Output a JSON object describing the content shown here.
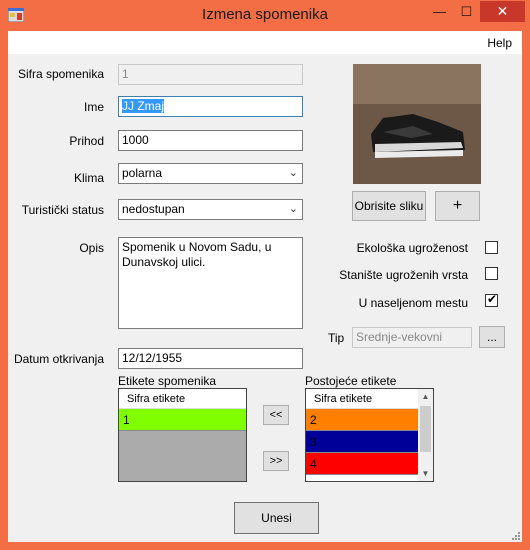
{
  "window": {
    "title": "Izmena spomenika",
    "controls": {
      "minimize": "—",
      "maximize": "☐",
      "close": "✕"
    }
  },
  "menu": {
    "help": "Help"
  },
  "form": {
    "sifra": {
      "label": "Sifra spomenika",
      "value": "1"
    },
    "ime": {
      "label": "Ime",
      "value": "JJ Zmaj"
    },
    "prihod": {
      "label": "Prihod",
      "value": "1000"
    },
    "klima": {
      "label": "Klima",
      "value": "polarna"
    },
    "turisticki_status": {
      "label": "Turistički status",
      "value": "nedostupan"
    },
    "opis": {
      "label": "Opis",
      "value": "Spomenik u Novom Sadu, u Dunavskoj ulici."
    },
    "datum": {
      "label": "Datum otkrivanja",
      "value": "12/12/1955"
    },
    "tip": {
      "label": "Tip",
      "value": "Srednje-vekovni",
      "browse_label": "..."
    }
  },
  "image_buttons": {
    "remove": "Obrisite sliku",
    "add": "+"
  },
  "checkboxes": [
    {
      "label": "Ekološka ugroženost",
      "checked": false
    },
    {
      "label": "Stanište ugroženih vrsta",
      "checked": false
    },
    {
      "label": "U naseljenom mestu",
      "checked": true
    }
  ],
  "checkbox_mark": "✔",
  "tags": {
    "assigned": {
      "title": "Etikete spomenika",
      "column": "Sifra etikete",
      "rows": [
        {
          "value": "1",
          "color": "#80ff00"
        }
      ]
    },
    "available": {
      "title": "Postojeće etikete",
      "column": "Sifra etikete",
      "rows": [
        {
          "value": "2",
          "color": "#ff8000"
        },
        {
          "value": "3",
          "color": "#000099"
        },
        {
          "value": "4",
          "color": "#ff0000"
        }
      ]
    },
    "move_left": "<<",
    "move_right": ">>"
  },
  "submit": "Unesi",
  "colors": {
    "title_bar": "#f36e45",
    "close_button": "#c7382b",
    "selection": "#3399ff"
  }
}
